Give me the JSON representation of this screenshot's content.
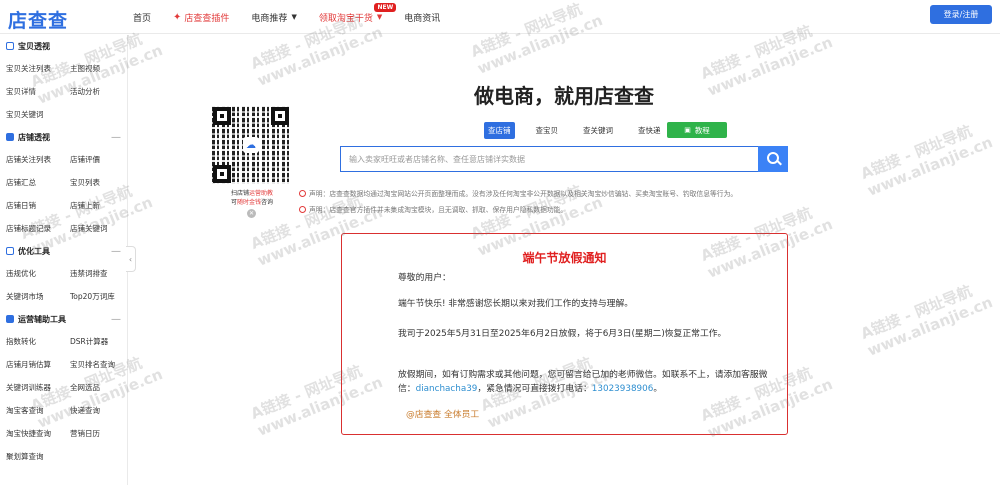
{
  "header": {
    "logo": "店查查",
    "nav": [
      {
        "label": "首页"
      },
      {
        "label": "店查查插件"
      },
      {
        "label": "电商推荐"
      },
      {
        "label": "领取淘宝干货"
      },
      {
        "label": "电商资讯"
      }
    ],
    "new_badge": "NEW",
    "login_label": "登录/注册"
  },
  "sidebar": {
    "sections": [
      {
        "title": "宝贝透视",
        "items": [
          "宝贝关注列表",
          "主图视频",
          "宝贝详情",
          "活动分析",
          "宝贝关键词"
        ]
      },
      {
        "title": "店铺透视",
        "items": [
          "店铺关注列表",
          "店铺评價",
          "店铺汇总",
          "宝贝列表",
          "店铺日销",
          "店铺上新",
          "店铺标题记录",
          "店铺关键词"
        ]
      },
      {
        "title": "优化工具",
        "items": [
          "违规优化",
          "违禁词排查",
          "关键词市场",
          "Top20万词库"
        ]
      },
      {
        "title": "运营辅助工具",
        "items": [
          "指数转化",
          "DSR计算器",
          "店铺月销估算",
          "宝贝排名查询",
          "关键词训练器",
          "全网选品",
          "淘宝客查询",
          "快递查询",
          "淘宝快捷查询",
          "营销日历",
          "聚划算查询"
        ]
      }
    ]
  },
  "qr": {
    "caption_1": "扫店铺",
    "caption_1_red": "运营助教",
    "caption_2": "可",
    "caption_2_red": "随时金钱",
    "caption_2_end": "咨询"
  },
  "hero": {
    "title": "做电商，就用店查查",
    "tabs": [
      "查店铺",
      "查宝贝",
      "查关键词",
      "查快递"
    ],
    "tutorial_label": "教程",
    "search_placeholder": "输入卖家旺旺或者店铺名称、查任意店铺详实数据",
    "disclaimer_1": "声明：店查查数据均通过淘宝网站公开页面整理而成。没有涉及任何淘宝非公开数据以及相关淘宝炒信骗钻、买卖淘宝账号、钓取信息等行为。",
    "disclaimer_2": "声明：店查查官方插件并未集成淘宝模块，且无调取、抓取、保存用户隐私数据功能。"
  },
  "notice": {
    "title": "端午节放假通知",
    "greeting": "尊敬的用户：",
    "line_1": "端午节快乐! 非常感谢您长期以来对我们工作的支持与理解。",
    "line_2": "我司于2025年5月31日至2025年6月2日放假，将于6月3日(星期二)恢复正常工作。",
    "line_3_start": "放假期间，如有订购需求或其他问题，您可留言给已加的老师微信。如联系不上，请添加客服微信：",
    "wechat": "dianchacha39",
    "line_3_mid": "，紧急情况可直接拨打电话：",
    "phone": "13023938906",
    "line_3_end": "。",
    "sign": "@店查查 全体员工"
  },
  "watermark": {
    "line_1": "A链接 - 网址导航",
    "line_2": "www.alianjie.cn"
  },
  "colors": {
    "brand_blue": "#2f6fe0",
    "notice_red": "#e02020",
    "tutorial_green": "#2fb34a"
  }
}
